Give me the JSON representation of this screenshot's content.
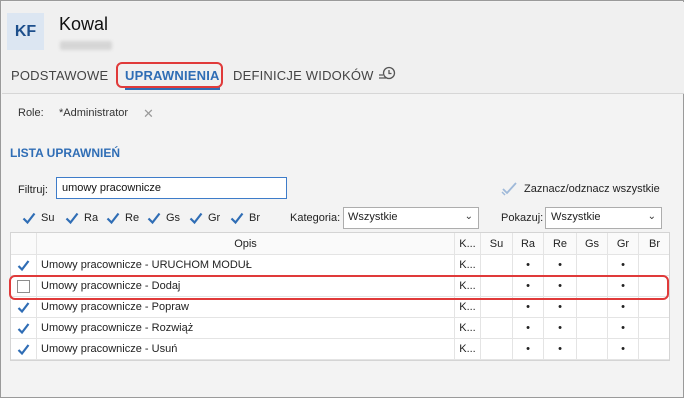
{
  "header": {
    "avatar_initials": "KF",
    "name": "Kowal"
  },
  "tabs": [
    {
      "label": "PODSTAWOWE",
      "active": false
    },
    {
      "label": "UPRAWNIENIA",
      "active": true
    },
    {
      "label": "DEFINICJE WIDOKÓW",
      "active": false
    }
  ],
  "history_icon": "history-icon",
  "role": {
    "label": "Role:",
    "value": "*Administrator",
    "close_icon": "close-icon"
  },
  "section_title": "LISTA UPRAWNIEŃ",
  "filter": {
    "label": "Filtruj:",
    "value": "umowy pracownicze"
  },
  "toggle_all": {
    "label": "Zaznacz/odznacz wszystkie",
    "icon": "check-all-icon"
  },
  "flags": [
    {
      "label": "Su",
      "checked": true
    },
    {
      "label": "Ra",
      "checked": true
    },
    {
      "label": "Re",
      "checked": true
    },
    {
      "label": "Gs",
      "checked": true
    },
    {
      "label": "Gr",
      "checked": true
    },
    {
      "label": "Br",
      "checked": true
    }
  ],
  "category": {
    "label": "Kategoria:",
    "selected": "Wszystkie"
  },
  "show": {
    "label": "Pokazuj:",
    "selected": "Wszystkie"
  },
  "table": {
    "columns": [
      "Opis",
      "K...",
      "Su",
      "Ra",
      "Re",
      "Gs",
      "Gr",
      "Br"
    ],
    "rows": [
      {
        "checked": true,
        "opis": "Umowy pracownicze - URUCHOM MODUŁ",
        "k": "K...",
        "su": "",
        "ra": "•",
        "re": "•",
        "gs": "",
        "gr": "•",
        "br": ""
      },
      {
        "checked": false,
        "opis": "Umowy pracownicze - Dodaj",
        "k": "K...",
        "su": "",
        "ra": "•",
        "re": "•",
        "gs": "",
        "gr": "•",
        "br": ""
      },
      {
        "checked": true,
        "opis": "Umowy pracownicze - Popraw",
        "k": "K...",
        "su": "",
        "ra": "•",
        "re": "•",
        "gs": "",
        "gr": "•",
        "br": ""
      },
      {
        "checked": true,
        "opis": "Umowy pracownicze - Rozwiąż",
        "k": "K...",
        "su": "",
        "ra": "•",
        "re": "•",
        "gs": "",
        "gr": "•",
        "br": ""
      },
      {
        "checked": true,
        "opis": "Umowy pracownicze - Usuń",
        "k": "K...",
        "su": "",
        "ra": "•",
        "re": "•",
        "gs": "",
        "gr": "•",
        "br": ""
      }
    ]
  },
  "colors": {
    "accent": "#2f6db5",
    "highlight": "#e03a3a",
    "check": "#2f6db5"
  }
}
